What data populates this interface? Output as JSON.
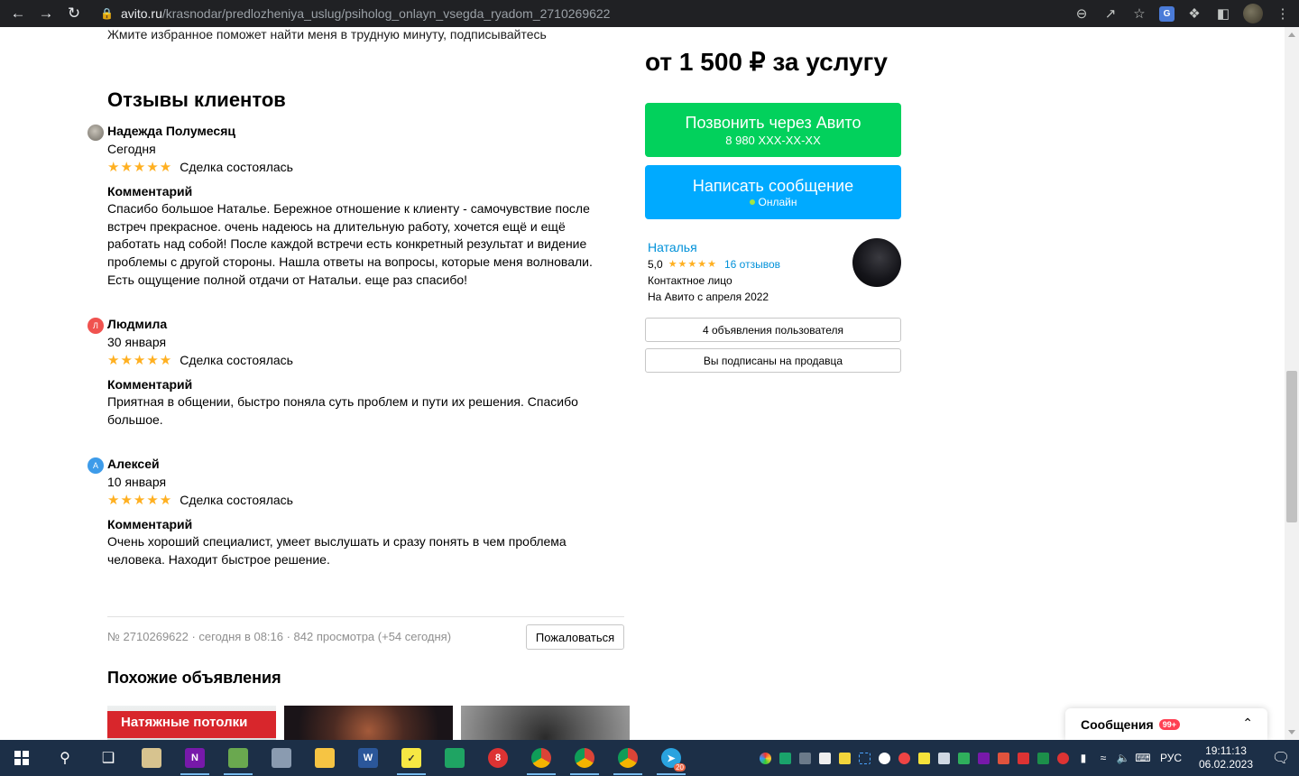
{
  "browser": {
    "url_host": "avito.ru",
    "url_path": "/krasnodar/predlozheniya_uslug/psiholog_onlayn_vsegda_ryadom_2710269622"
  },
  "listing": {
    "top_text": "Жмите избранное поможет найти меня в трудную минуту, подписывайтесь",
    "price": "от 1 500 ₽ за услугу",
    "call_button": {
      "label": "Позвонить через Авито",
      "phone": "8 980 XXX-XX-XX"
    },
    "message_button": {
      "label": "Написать сообщение",
      "status": "Онлайн"
    },
    "item_meta": "№ 2710269622 · сегодня в 08:16 · 842 просмотра (+54 сегодня)",
    "complain_label": "Пожаловаться",
    "similar_title": "Похожие объявления",
    "similar_items": [
      {
        "thumb_text": "Натяжные потолки"
      },
      {
        "thumb_text": ""
      },
      {
        "thumb_text": ""
      }
    ]
  },
  "reviews": {
    "title": "Отзывы клиентов",
    "comment_label": "Комментарий",
    "items": [
      {
        "initial": "",
        "avatar_color": "#8a8a8a",
        "name": "Надежда Полумесяц",
        "date": "Сегодня",
        "stars": "★★★★★",
        "deal": "Сделка состоялась",
        "text_lines": [
          "Спасибо большое Наталье. Бережное отношение к клиенту - самочувствие после",
          "встреч прекрасное. очень надеюсь на длительную работу, хочется ещё и ещё",
          "работать над собой! После каждой встречи есть конкретный результат и видение",
          "проблемы с другой стороны. Нашла ответы на вопросы, которые меня волновали.",
          "Есть ощущение полной отдачи от Натальи. еще раз спасибо!"
        ]
      },
      {
        "initial": "Л",
        "avatar_color": "#f0524f",
        "name": "Людмила",
        "date": "30 января",
        "stars": "★★★★★",
        "deal": "Сделка состоялась",
        "text_lines": [
          "Приятная в общении, быстро поняла суть проблем и пути их решения. Спасибо",
          "большое."
        ]
      },
      {
        "initial": "А",
        "avatar_color": "#3d9be9",
        "name": "Алексей",
        "date": "10 января",
        "stars": "★★★★★",
        "deal": "Сделка состоялась",
        "text_lines": [
          "Очень хороший специалист, умеет выслушать и сразу понять в чем проблема",
          "человека. Находит быстрое решение."
        ]
      }
    ]
  },
  "seller": {
    "name": "Наталья",
    "rating": "5,0",
    "stars": "★★★★★",
    "reviews_link": "16 отзывов",
    "role": "Контактное лицо",
    "since": "На Авито с апреля 2022",
    "listings_button": "4 объявления пользователя",
    "subscribed_button": "Вы подписаны на продавца"
  },
  "messages_widget": {
    "label": "Сообщения",
    "badge": "99+"
  },
  "taskbar": {
    "lang": "РУС",
    "time": "19:11:13",
    "date": "06.02.2023",
    "telegram_badge": "20"
  },
  "colors": {
    "call_green": "#02d15c",
    "message_blue": "#00aaff",
    "link_blue": "#0091d9",
    "star_gold": "#ffb021"
  }
}
